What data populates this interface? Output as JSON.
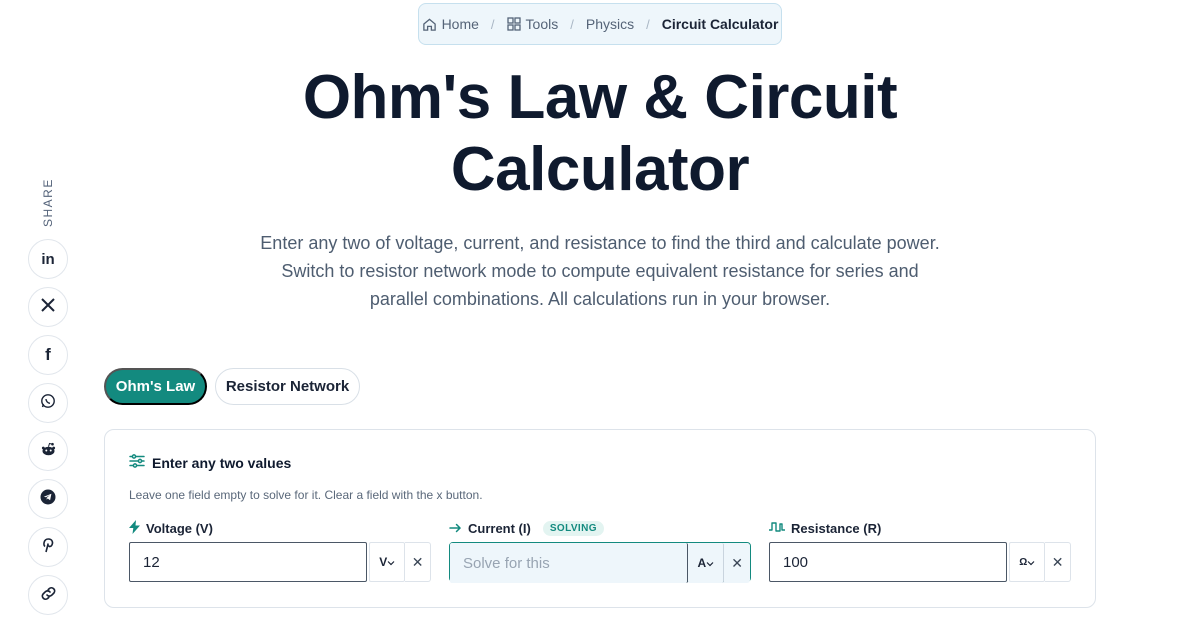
{
  "breadcrumb": {
    "items": [
      {
        "label": "Home",
        "icon": "home-icon"
      },
      {
        "label": "Tools",
        "icon": "grid-icon"
      },
      {
        "label": "Physics"
      },
      {
        "label": "Circuit Calculator"
      }
    ],
    "separator": "/"
  },
  "page": {
    "title": "Ohm's Law & Circuit Calculator",
    "subtitle": "Enter any two of voltage, current, and resistance to find the third and calculate power. Switch to resistor network mode to compute equivalent resistance for series and parallel combinations. All calculations run in your browser."
  },
  "share": {
    "label": "SHARE",
    "buttons": [
      {
        "name": "linkedin",
        "glyph": "in"
      },
      {
        "name": "x",
        "glyph": "𝕏"
      },
      {
        "name": "facebook",
        "glyph": "f"
      },
      {
        "name": "whatsapp",
        "glyph": ""
      },
      {
        "name": "reddit",
        "glyph": ""
      },
      {
        "name": "telegram",
        "glyph": ""
      },
      {
        "name": "pinterest",
        "glyph": "P"
      },
      {
        "name": "copy-link",
        "glyph": ""
      }
    ]
  },
  "tabs": [
    {
      "label": "Ohm's Law",
      "active": true
    },
    {
      "label": "Resistor Network",
      "active": false
    }
  ],
  "card": {
    "heading": "Enter any two values",
    "hint": "Leave one field empty to solve for it. Clear a field with the x button.",
    "fields": [
      {
        "label": "Voltage (V)",
        "value": "12",
        "placeholder": "",
        "unit": "V",
        "icon": "bolt-icon",
        "badge": ""
      },
      {
        "label": "Current (I)",
        "value": "",
        "placeholder": "Solve for this",
        "unit": "A",
        "icon": "arrow-right-icon",
        "badge": "SOLVING"
      },
      {
        "label": "Resistance (R)",
        "value": "100",
        "placeholder": "",
        "unit": "Ω",
        "icon": "resistor-wave-icon",
        "badge": ""
      }
    ],
    "clear_glyph": "✕"
  },
  "colors": {
    "accent": "#138a7f",
    "accent_light": "#e3f4f1",
    "breadcrumb_bg": "#eef6fb",
    "text_dark": "#0f1a2e"
  }
}
